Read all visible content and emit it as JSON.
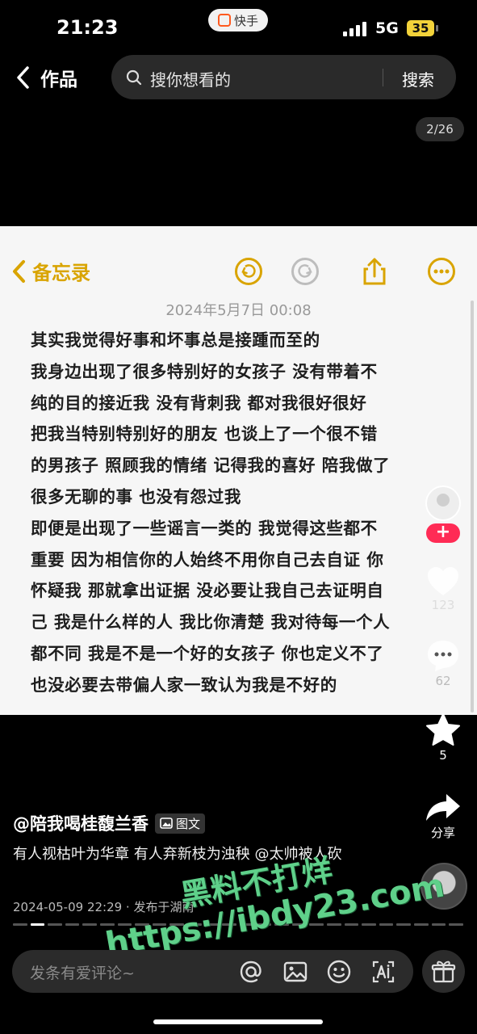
{
  "status_bar": {
    "time": "21:23",
    "app_name": "快手",
    "network": "5G",
    "battery": "35"
  },
  "nav": {
    "back_label": "作品",
    "search_placeholder": "搜你想看的",
    "search_button": "搜索",
    "page_counter": "2/26"
  },
  "memo": {
    "back_label": "备忘录",
    "date": "2024年5月7日 00:08",
    "accent_color": "#d9a400",
    "lines": [
      "其实我觉得好事和坏事总是接踵而至的",
      "我身边出现了很多特别好的女孩子 没有带着不",
      "纯的目的接近我 没有背刺我 都对我很好很好",
      "把我当特别特别好的朋友 也谈上了一个很不错",
      "的男孩子 照顾我的情绪 记得我的喜好 陪我做了",
      "很多无聊的事 也没有怨过我",
      "即便是出现了一些谣言一类的 我觉得这些都不",
      "重要 因为相信你的人始终不用你自己去自证 你",
      "怀疑我 那就拿出证据 没必要让我自己去证明自",
      "己 我是什么样的人 我比你清楚 我对待每一个人",
      "都不同 我是不是一个好的女孩子 你也定义不了",
      "也没必要去带偏人家一致认为我是不好的"
    ]
  },
  "rail": {
    "likes": "123",
    "comments": "62",
    "favorites": "5",
    "share": "分享",
    "follow": "+"
  },
  "post": {
    "author": "@陪我喝桂馥兰香",
    "tag": "图文",
    "caption": "有人视枯叶为华章 有人弃新枝为浊秧 @太帅被人砍",
    "meta": "2024-05-09 22:29 · 发布于湖南"
  },
  "watermark": {
    "line1": "黑料不打烊",
    "line2": "https://ibdy23.com"
  },
  "comment": {
    "placeholder": "发条有爱评论~"
  }
}
